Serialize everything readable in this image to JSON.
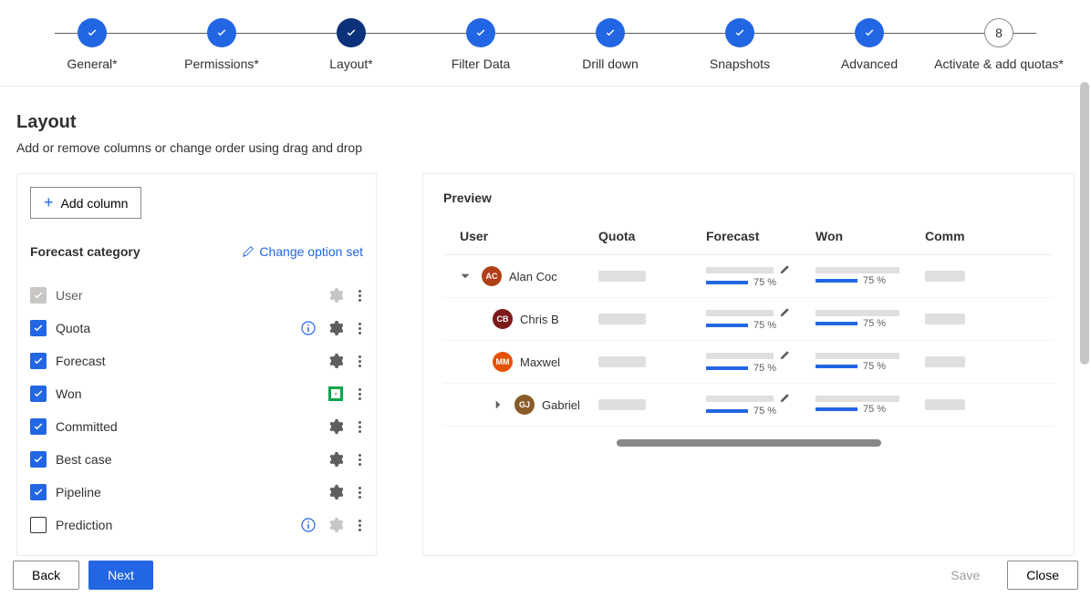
{
  "stepper": [
    {
      "label": "General*",
      "state": "done"
    },
    {
      "label": "Permissions*",
      "state": "done"
    },
    {
      "label": "Layout*",
      "state": "active"
    },
    {
      "label": "Filter Data",
      "state": "done"
    },
    {
      "label": "Drill down",
      "state": "done"
    },
    {
      "label": "Snapshots",
      "state": "done"
    },
    {
      "label": "Advanced",
      "state": "done"
    },
    {
      "label": "Activate & add quotas*",
      "state": "pending",
      "num": "8"
    }
  ],
  "page": {
    "title": "Layout",
    "description": "Add or remove columns or change order using drag and drop"
  },
  "addColumn": "Add column",
  "forecastCategory": {
    "title": "Forecast category",
    "changeLink": "Change option set"
  },
  "columns": [
    {
      "label": "User",
      "checked": "locked",
      "info": false,
      "gearHighlight": false
    },
    {
      "label": "Quota",
      "checked": "checked",
      "info": true,
      "gearHighlight": false
    },
    {
      "label": "Forecast",
      "checked": "checked",
      "info": false,
      "gearHighlight": false
    },
    {
      "label": "Won",
      "checked": "checked",
      "info": false,
      "gearHighlight": true
    },
    {
      "label": "Committed",
      "checked": "checked",
      "info": false,
      "gearHighlight": false
    },
    {
      "label": "Best case",
      "checked": "checked",
      "info": false,
      "gearHighlight": false
    },
    {
      "label": "Pipeline",
      "checked": "checked",
      "info": false,
      "gearHighlight": false
    },
    {
      "label": "Prediction",
      "checked": "empty",
      "info": true,
      "gearHighlight": false
    }
  ],
  "preview": {
    "title": "Preview",
    "headers": {
      "user": "User",
      "quota": "Quota",
      "forecast": "Forecast",
      "won": "Won",
      "commit": "Comm"
    },
    "rows": [
      {
        "expand": "down",
        "initials": "AC",
        "color": "#b04018",
        "name": "Alan Coc",
        "forecastPct": "75 %",
        "wonPct": "75 %",
        "editable": true,
        "indent": 1
      },
      {
        "expand": "",
        "initials": "CB",
        "color": "#7d1a1a",
        "name": "Chris B",
        "forecastPct": "75 %",
        "wonPct": "75 %",
        "editable": true,
        "indent": 2
      },
      {
        "expand": "",
        "initials": "MM",
        "color": "#e55100",
        "name": "Maxwel",
        "forecastPct": "75 %",
        "wonPct": "75 %",
        "editable": true,
        "indent": 2
      },
      {
        "expand": "right",
        "initials": "GJ",
        "color": "#8a5a28",
        "name": "Gabriel",
        "forecastPct": "75 %",
        "wonPct": "75 %",
        "editable": true,
        "indent": 2
      }
    ]
  },
  "footer": {
    "back": "Back",
    "next": "Next",
    "save": "Save",
    "close": "Close"
  }
}
